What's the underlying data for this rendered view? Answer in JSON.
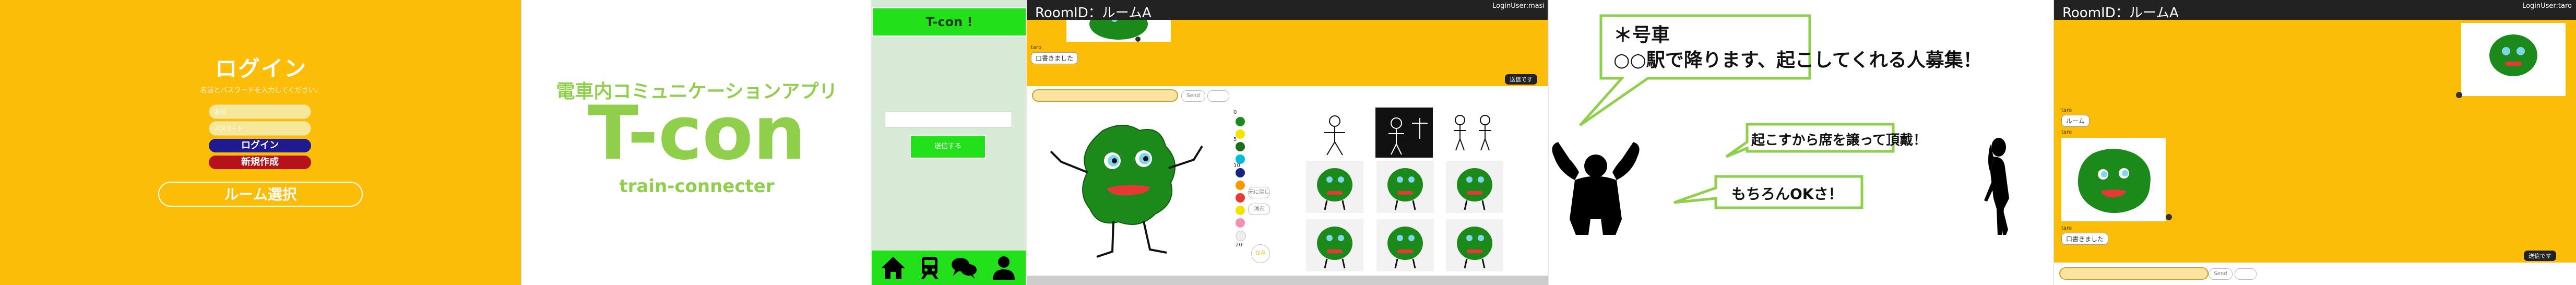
{
  "login": {
    "title": "ログイン",
    "subtitle": "名前とパスワードを入力してください。",
    "name_placeholder": "名前",
    "password_placeholder": "パスワード",
    "login_button": "ログイン",
    "signup_button": "新規作成",
    "room_button": "ルーム選択",
    "colors": {
      "background": "#fbbd08",
      "login_button": "#1f1a8f",
      "signup_button": "#b5121b"
    }
  },
  "logo": {
    "app_name": "電車内コミュニケーションアプリ",
    "title": "T-con",
    "subtitle": "train-connecter",
    "color": "#8fcf4c"
  },
  "mobile": {
    "header_title": "T-con !",
    "button_label": "送信する",
    "nav_icons": [
      "home-icon",
      "train-icon",
      "chat-icon",
      "user-icon"
    ],
    "accent": "#22e11a"
  },
  "chat_draw": {
    "room_title": "RoomID：ルームA",
    "login_user": "LoginUser:masi",
    "messages": [
      {
        "sender": "tarо",
        "text": "口書きました"
      }
    ],
    "send_button": "送信です",
    "input_buttons": [
      "Send",
      ""
    ],
    "size_labels": [
      "0",
      "5",
      "10",
      "20"
    ],
    "tool_buttons": [
      "元に戻し",
      "消去"
    ],
    "save_button": "保存",
    "colors": [
      "#1b8a1b",
      "#f2e400",
      "#1b6e1b",
      "#00bcd4",
      "#1a237e",
      "#ff9800",
      "#e53935",
      "#f2e400",
      "#f48fb1",
      "#eeeeee"
    ]
  },
  "story": {
    "announcement": "＊号車\n○○駅で降ります、起こしてくれる人募集！",
    "reply_ok": "もちろんOKさ！",
    "reply_seat": "起こすから席を譲って頂戴！",
    "bubble_color": "#8fcf4c"
  },
  "chat": {
    "room_title": "RoomID：ルームA",
    "login_user": "LoginUser:taro",
    "messages": [
      {
        "sender": "taro",
        "text": "ルーム"
      },
      {
        "sender": "taro",
        "text": "口書きました"
      }
    ],
    "send_button": "送信です",
    "input_buttons": [
      "Send",
      ""
    ]
  }
}
